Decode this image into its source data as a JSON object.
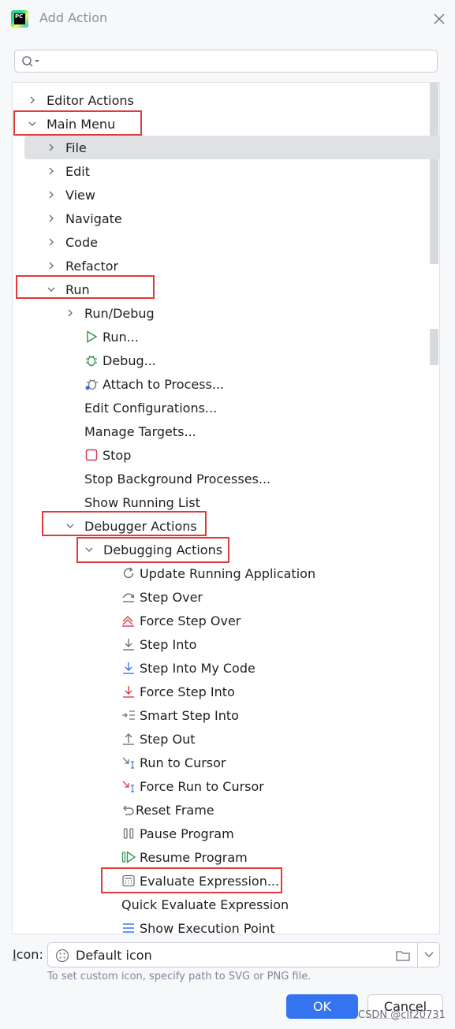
{
  "window": {
    "title": "Add Action"
  },
  "search": {
    "value": "",
    "placeholder": ""
  },
  "tree": {
    "editor_actions": "Editor Actions",
    "main_menu": "Main Menu",
    "file": "File",
    "edit": "Edit",
    "view": "View",
    "navigate": "Navigate",
    "code": "Code",
    "refactor": "Refactor",
    "run": "Run",
    "run_debug": "Run/Debug",
    "run_action": "Run...",
    "debug_action": "Debug...",
    "attach": "Attach to Process...",
    "edit_configs": "Edit Configurations...",
    "manage_targets": "Manage Targets...",
    "stop": "Stop",
    "stop_background": "Stop Background Processes...",
    "show_running": "Show Running List",
    "debugger_actions": "Debugger Actions",
    "debugging_actions": "Debugging Actions",
    "update_running": "Update Running Application",
    "step_over": "Step Over",
    "force_step_over": "Force Step Over",
    "step_into": "Step Into",
    "step_into_my_code": "Step Into My Code",
    "force_step_into": "Force Step Into",
    "smart_step_into": "Smart Step Into",
    "step_out": "Step Out",
    "run_to_cursor": "Run to Cursor",
    "force_run_to_cursor": "Force Run to Cursor",
    "reset_frame": "Reset Frame",
    "pause_program": "Pause Program",
    "resume_program": "Resume Program",
    "evaluate_expression": "Evaluate Expression...",
    "quick_evaluate": "Quick Evaluate Expression",
    "show_execution_point": "Show Execution Point"
  },
  "icon_field": {
    "label_mnemonic": "I",
    "label_rest": "con:",
    "value": "Default icon",
    "hint": "To set custom icon, specify path to SVG or PNG file."
  },
  "buttons": {
    "ok": "OK",
    "cancel": "Cancel"
  },
  "watermark": "CSDN @clf20731",
  "colors": {
    "accent": "#3574f0",
    "highlight_box": "#e03a3a",
    "selection": "#dfe1e5"
  }
}
